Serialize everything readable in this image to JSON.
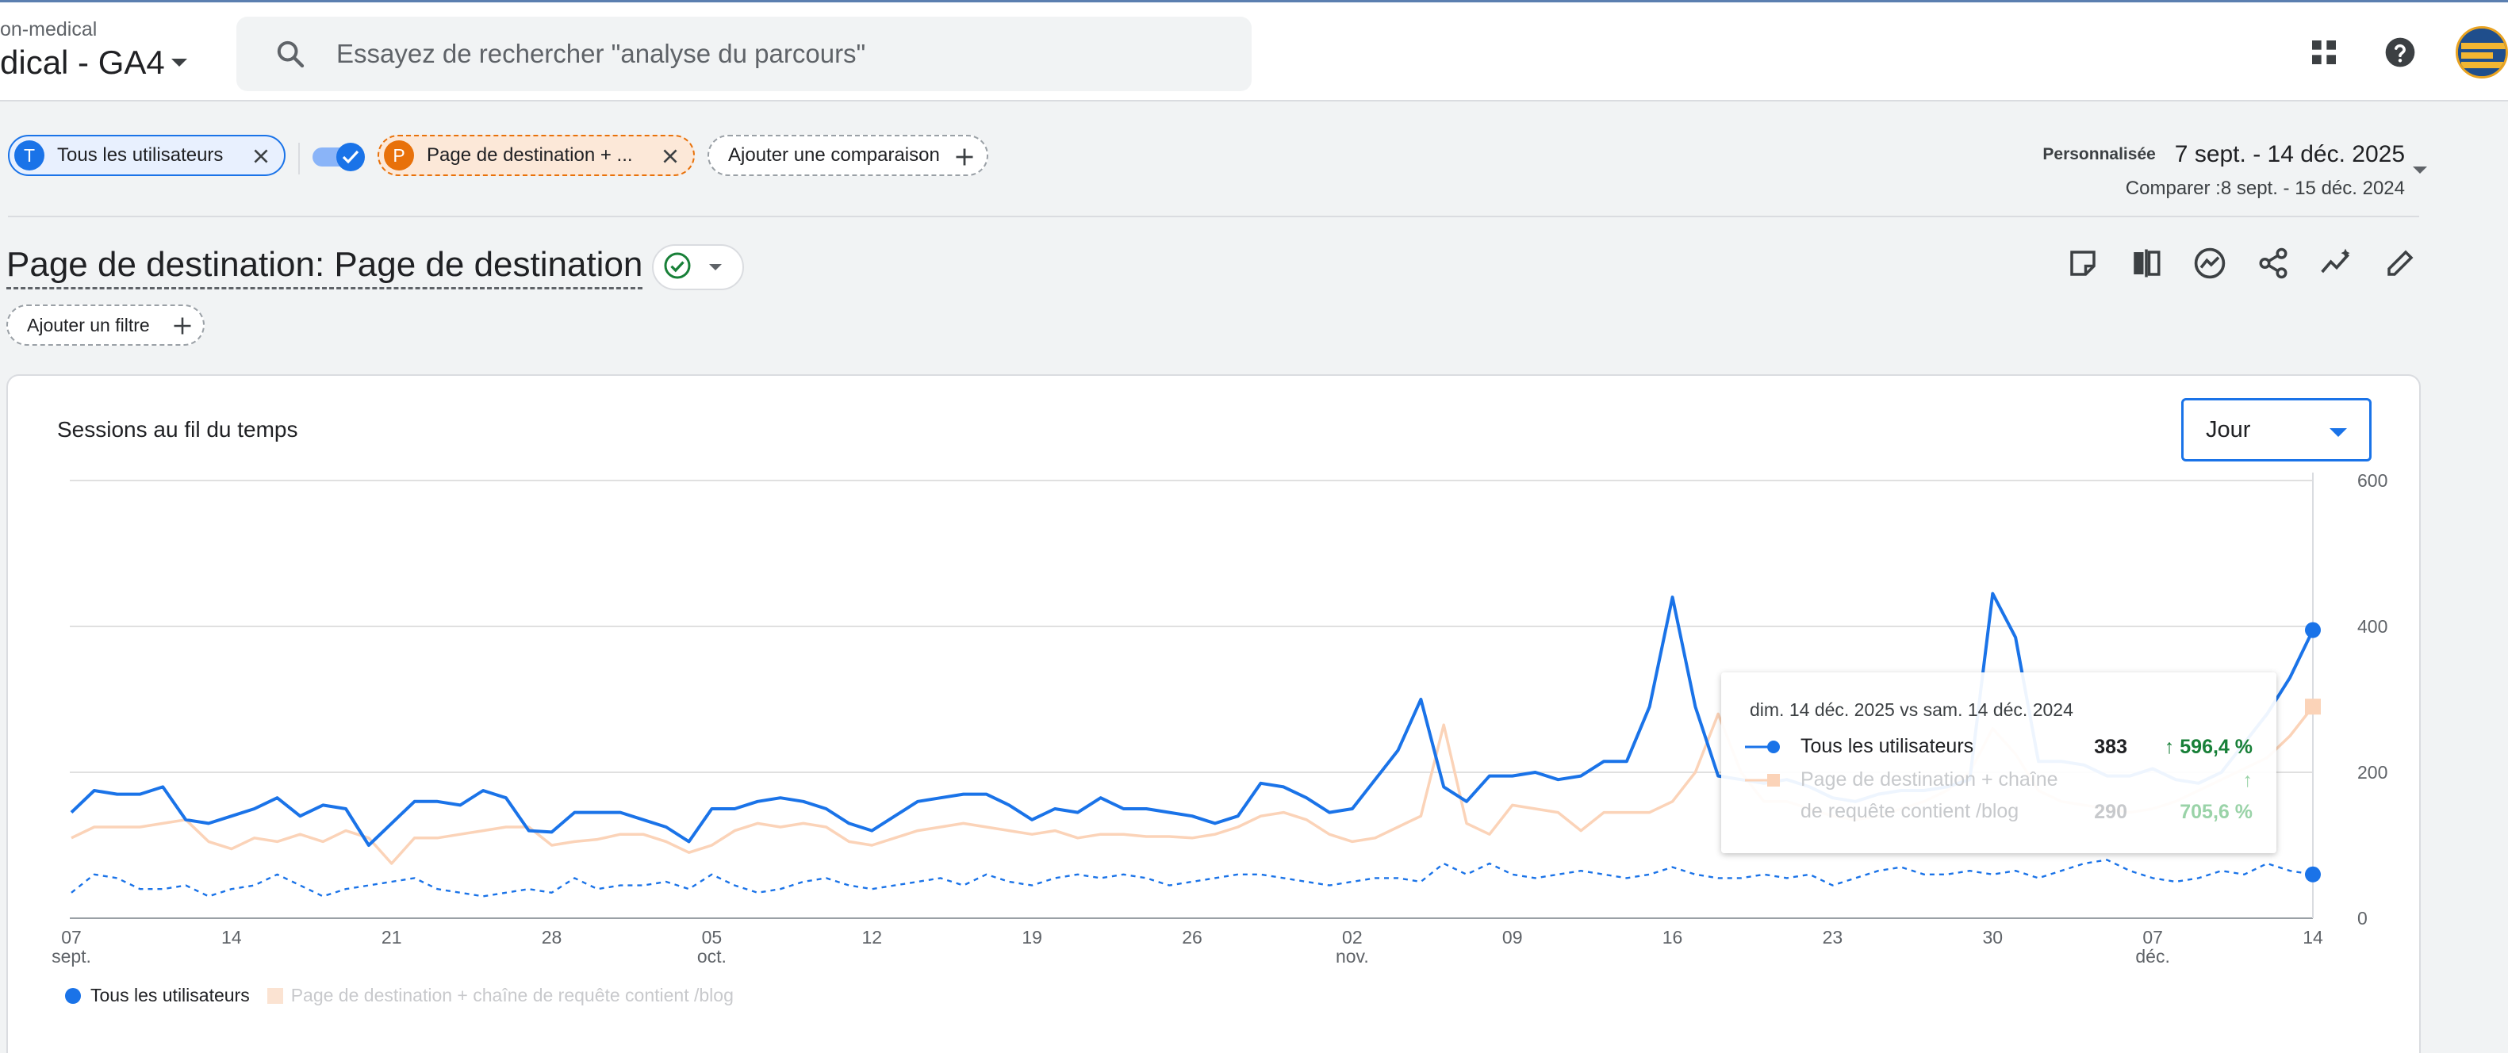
{
  "header": {
    "account": "on-medical",
    "property": "dical  - GA4",
    "search_placeholder": "Essayez de rechercher \"analyse du parcours\""
  },
  "comparisons": {
    "chip1_badge": "T",
    "chip1_label": "Tous les utilisateurs",
    "chip2_badge": "P",
    "chip2_label": "Page de destination + ...",
    "add_label": "Ajouter une comparaison"
  },
  "daterange": {
    "tag": "Personnalisée",
    "main": "7 sept. - 14 déc. 2025",
    "compare": "Comparer :8 sept. - 15 déc. 2024"
  },
  "report": {
    "title": "Page de destination: Page de destination",
    "add_filter": "Ajouter un filtre"
  },
  "card": {
    "title": "Sessions au fil du temps",
    "granularity": "Jour"
  },
  "tooltip": {
    "header": "dim. 14 déc. 2025 vs sam. 14 déc. 2024",
    "row1_label": "Tous les utilisateurs",
    "row1_value": "383",
    "row1_change": "↑ 596,4 %",
    "row2_label_line1": "Page de destination + chaîne",
    "row2_label_line2": "de requête contient /blog",
    "row2_value": "290",
    "row2_arrow": "↑",
    "row2_change": "705,6 %"
  },
  "colors": {
    "series_all": "#1a73e8",
    "series_blog": "#fbd3b8",
    "accent_orange": "#e8710a",
    "positive": "#188038"
  },
  "chart_data": {
    "type": "line",
    "title": "Sessions au fil du temps",
    "ylim": [
      0,
      600
    ],
    "y_ticks": [
      "600",
      "400",
      "200",
      "0"
    ],
    "x_ticks": [
      {
        "label": "07",
        "sub": "sept.",
        "day": 0
      },
      {
        "label": "14",
        "sub": "",
        "day": 7
      },
      {
        "label": "21",
        "sub": "",
        "day": 14
      },
      {
        "label": "28",
        "sub": "",
        "day": 21
      },
      {
        "label": "05",
        "sub": "oct.",
        "day": 28
      },
      {
        "label": "12",
        "sub": "",
        "day": 35
      },
      {
        "label": "19",
        "sub": "",
        "day": 42
      },
      {
        "label": "26",
        "sub": "",
        "day": 49
      },
      {
        "label": "02",
        "sub": "nov.",
        "day": 56
      },
      {
        "label": "09",
        "sub": "",
        "day": 63
      },
      {
        "label": "16",
        "sub": "",
        "day": 70
      },
      {
        "label": "23",
        "sub": "",
        "day": 77
      },
      {
        "label": "30",
        "sub": "",
        "day": 84
      },
      {
        "label": "07",
        "sub": "déc.",
        "day": 91
      },
      {
        "label": "14",
        "sub": "",
        "day": 98
      }
    ],
    "series": [
      {
        "name": "Tous les utilisateurs",
        "style": "solid",
        "values": [
          145,
          175,
          170,
          170,
          180,
          135,
          130,
          140,
          150,
          165,
          140,
          155,
          150,
          100,
          130,
          160,
          160,
          155,
          175,
          165,
          120,
          118,
          145,
          145,
          145,
          135,
          125,
          105,
          150,
          150,
          160,
          165,
          160,
          150,
          130,
          120,
          140,
          160,
          165,
          170,
          170,
          155,
          135,
          150,
          145,
          165,
          150,
          150,
          145,
          140,
          130,
          140,
          185,
          180,
          165,
          145,
          150,
          190,
          230,
          300,
          180,
          160,
          195,
          195,
          200,
          190,
          195,
          215,
          215,
          290,
          440,
          290,
          195,
          190,
          185,
          190,
          180,
          165,
          160,
          170,
          175,
          175,
          180,
          190,
          445,
          385,
          215,
          215,
          210,
          195,
          195,
          205,
          190,
          185,
          200,
          240,
          280,
          330,
          395
        ]
      },
      {
        "name": "Page de destination + chaîne de requête contient /blog",
        "style": "solid",
        "values": [
          110,
          125,
          125,
          125,
          130,
          135,
          105,
          95,
          110,
          105,
          115,
          105,
          120,
          110,
          75,
          110,
          110,
          115,
          120,
          125,
          125,
          100,
          105,
          108,
          115,
          115,
          105,
          90,
          100,
          120,
          130,
          125,
          130,
          125,
          105,
          100,
          110,
          120,
          125,
          130,
          125,
          120,
          115,
          120,
          110,
          115,
          115,
          112,
          112,
          110,
          115,
          125,
          140,
          145,
          135,
          115,
          105,
          110,
          125,
          140,
          265,
          130,
          115,
          155,
          150,
          145,
          120,
          145,
          145,
          145,
          160,
          200,
          280,
          200,
          160,
          160,
          150,
          140,
          135,
          140,
          150,
          160,
          175,
          200,
          260,
          225,
          175,
          160,
          155,
          150,
          145,
          150,
          160,
          175,
          190,
          205,
          220,
          250,
          290
        ]
      },
      {
        "name": "Tous les utilisateurs (période précédente)",
        "style": "dashed",
        "values": [
          35,
          60,
          55,
          40,
          40,
          45,
          30,
          40,
          45,
          60,
          45,
          30,
          40,
          45,
          50,
          55,
          40,
          35,
          30,
          35,
          40,
          35,
          55,
          40,
          45,
          45,
          50,
          40,
          60,
          45,
          35,
          40,
          50,
          55,
          45,
          40,
          45,
          50,
          55,
          45,
          60,
          50,
          45,
          55,
          60,
          55,
          60,
          55,
          45,
          50,
          55,
          60,
          60,
          55,
          50,
          45,
          50,
          55,
          55,
          50,
          75,
          60,
          75,
          60,
          55,
          60,
          65,
          60,
          55,
          60,
          70,
          60,
          55,
          55,
          60,
          55,
          60,
          45,
          55,
          65,
          70,
          60,
          60,
          65,
          60,
          65,
          55,
          65,
          75,
          80,
          65,
          55,
          50,
          55,
          65,
          60,
          75,
          65,
          60
        ]
      }
    ],
    "highlight_day": 98
  }
}
